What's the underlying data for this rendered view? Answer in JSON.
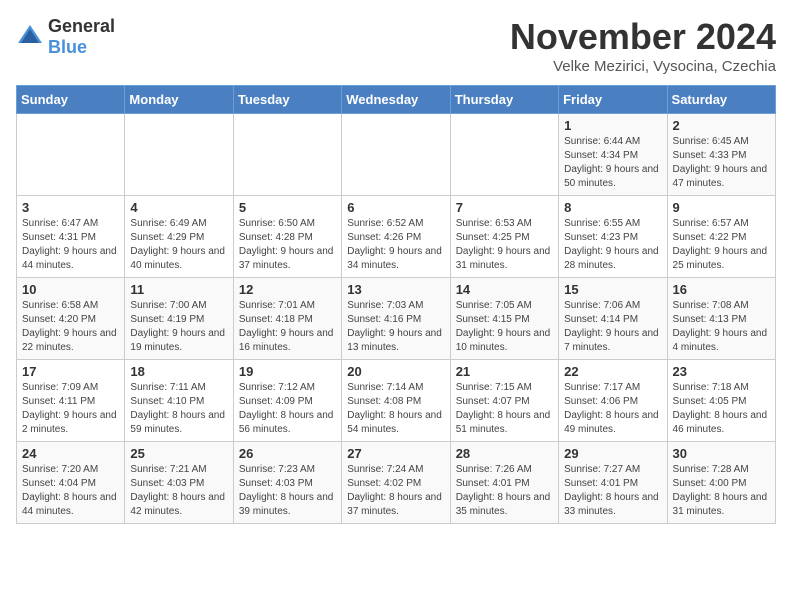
{
  "logo": {
    "general": "General",
    "blue": "Blue"
  },
  "title": "November 2024",
  "subtitle": "Velke Mezirici, Vysocina, Czechia",
  "days_header": [
    "Sunday",
    "Monday",
    "Tuesday",
    "Wednesday",
    "Thursday",
    "Friday",
    "Saturday"
  ],
  "weeks": [
    [
      {
        "day": "",
        "info": ""
      },
      {
        "day": "",
        "info": ""
      },
      {
        "day": "",
        "info": ""
      },
      {
        "day": "",
        "info": ""
      },
      {
        "day": "",
        "info": ""
      },
      {
        "day": "1",
        "info": "Sunrise: 6:44 AM\nSunset: 4:34 PM\nDaylight: 9 hours and 50 minutes."
      },
      {
        "day": "2",
        "info": "Sunrise: 6:45 AM\nSunset: 4:33 PM\nDaylight: 9 hours and 47 minutes."
      }
    ],
    [
      {
        "day": "3",
        "info": "Sunrise: 6:47 AM\nSunset: 4:31 PM\nDaylight: 9 hours and 44 minutes."
      },
      {
        "day": "4",
        "info": "Sunrise: 6:49 AM\nSunset: 4:29 PM\nDaylight: 9 hours and 40 minutes."
      },
      {
        "day": "5",
        "info": "Sunrise: 6:50 AM\nSunset: 4:28 PM\nDaylight: 9 hours and 37 minutes."
      },
      {
        "day": "6",
        "info": "Sunrise: 6:52 AM\nSunset: 4:26 PM\nDaylight: 9 hours and 34 minutes."
      },
      {
        "day": "7",
        "info": "Sunrise: 6:53 AM\nSunset: 4:25 PM\nDaylight: 9 hours and 31 minutes."
      },
      {
        "day": "8",
        "info": "Sunrise: 6:55 AM\nSunset: 4:23 PM\nDaylight: 9 hours and 28 minutes."
      },
      {
        "day": "9",
        "info": "Sunrise: 6:57 AM\nSunset: 4:22 PM\nDaylight: 9 hours and 25 minutes."
      }
    ],
    [
      {
        "day": "10",
        "info": "Sunrise: 6:58 AM\nSunset: 4:20 PM\nDaylight: 9 hours and 22 minutes."
      },
      {
        "day": "11",
        "info": "Sunrise: 7:00 AM\nSunset: 4:19 PM\nDaylight: 9 hours and 19 minutes."
      },
      {
        "day": "12",
        "info": "Sunrise: 7:01 AM\nSunset: 4:18 PM\nDaylight: 9 hours and 16 minutes."
      },
      {
        "day": "13",
        "info": "Sunrise: 7:03 AM\nSunset: 4:16 PM\nDaylight: 9 hours and 13 minutes."
      },
      {
        "day": "14",
        "info": "Sunrise: 7:05 AM\nSunset: 4:15 PM\nDaylight: 9 hours and 10 minutes."
      },
      {
        "day": "15",
        "info": "Sunrise: 7:06 AM\nSunset: 4:14 PM\nDaylight: 9 hours and 7 minutes."
      },
      {
        "day": "16",
        "info": "Sunrise: 7:08 AM\nSunset: 4:13 PM\nDaylight: 9 hours and 4 minutes."
      }
    ],
    [
      {
        "day": "17",
        "info": "Sunrise: 7:09 AM\nSunset: 4:11 PM\nDaylight: 9 hours and 2 minutes."
      },
      {
        "day": "18",
        "info": "Sunrise: 7:11 AM\nSunset: 4:10 PM\nDaylight: 8 hours and 59 minutes."
      },
      {
        "day": "19",
        "info": "Sunrise: 7:12 AM\nSunset: 4:09 PM\nDaylight: 8 hours and 56 minutes."
      },
      {
        "day": "20",
        "info": "Sunrise: 7:14 AM\nSunset: 4:08 PM\nDaylight: 8 hours and 54 minutes."
      },
      {
        "day": "21",
        "info": "Sunrise: 7:15 AM\nSunset: 4:07 PM\nDaylight: 8 hours and 51 minutes."
      },
      {
        "day": "22",
        "info": "Sunrise: 7:17 AM\nSunset: 4:06 PM\nDaylight: 8 hours and 49 minutes."
      },
      {
        "day": "23",
        "info": "Sunrise: 7:18 AM\nSunset: 4:05 PM\nDaylight: 8 hours and 46 minutes."
      }
    ],
    [
      {
        "day": "24",
        "info": "Sunrise: 7:20 AM\nSunset: 4:04 PM\nDaylight: 8 hours and 44 minutes."
      },
      {
        "day": "25",
        "info": "Sunrise: 7:21 AM\nSunset: 4:03 PM\nDaylight: 8 hours and 42 minutes."
      },
      {
        "day": "26",
        "info": "Sunrise: 7:23 AM\nSunset: 4:03 PM\nDaylight: 8 hours and 39 minutes."
      },
      {
        "day": "27",
        "info": "Sunrise: 7:24 AM\nSunset: 4:02 PM\nDaylight: 8 hours and 37 minutes."
      },
      {
        "day": "28",
        "info": "Sunrise: 7:26 AM\nSunset: 4:01 PM\nDaylight: 8 hours and 35 minutes."
      },
      {
        "day": "29",
        "info": "Sunrise: 7:27 AM\nSunset: 4:01 PM\nDaylight: 8 hours and 33 minutes."
      },
      {
        "day": "30",
        "info": "Sunrise: 7:28 AM\nSunset: 4:00 PM\nDaylight: 8 hours and 31 minutes."
      }
    ]
  ]
}
